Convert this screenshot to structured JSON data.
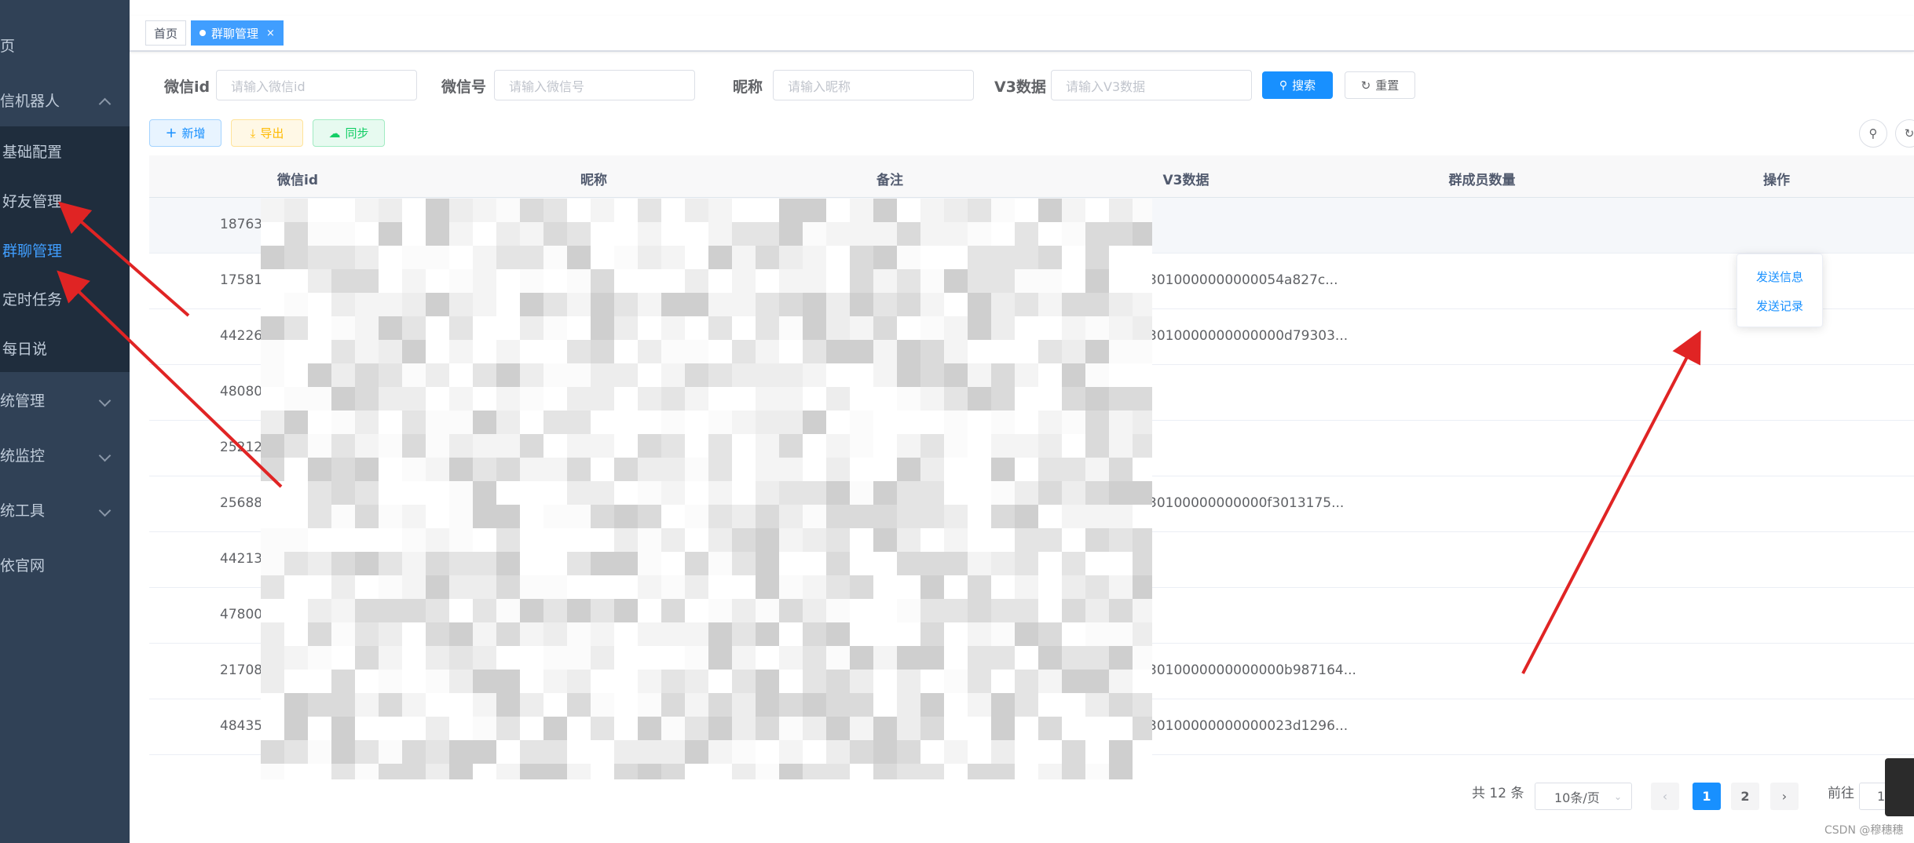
{
  "sidebar": {
    "items": [
      {
        "label": "页"
      },
      {
        "label": "信机器人"
      },
      {
        "label": "基础配置"
      },
      {
        "label": "好友管理"
      },
      {
        "label": "群聊管理"
      },
      {
        "label": "定时任务"
      },
      {
        "label": "每日说"
      },
      {
        "label": "统管理"
      },
      {
        "label": "统监控"
      },
      {
        "label": "统工具"
      },
      {
        "label": "依官网"
      }
    ]
  },
  "tabs": [
    {
      "label": "首页"
    },
    {
      "label": "群聊管理",
      "close": "×"
    }
  ],
  "search": {
    "fields": [
      {
        "label": "微信id",
        "placeholder": "请输入微信id"
      },
      {
        "label": "微信号",
        "placeholder": "请输入微信号"
      },
      {
        "label": "昵称",
        "placeholder": "请输入昵称"
      },
      {
        "label": "V3数据",
        "placeholder": "请输入V3数据"
      }
    ],
    "search_label": "搜索",
    "reset_label": "重置"
  },
  "toolbar": {
    "add_label": "新增",
    "export_label": "导出",
    "sync_label": "同步"
  },
  "table": {
    "headers": [
      "微信id",
      "昵称",
      "备注",
      "V3数据",
      "群成员数量",
      "操作"
    ],
    "rows": [
      {
        "id": "187634",
        "v3": ""
      },
      {
        "id": "175818",
        "v3": "3010000000000054a827c..."
      },
      {
        "id": "442267",
        "v3": "3010000000000000d79303..."
      },
      {
        "id": "480802",
        "v3": ""
      },
      {
        "id": "252122",
        "v3": ""
      },
      {
        "id": "256885",
        "v3": "30100000000000f3013175..."
      },
      {
        "id": "442130",
        "v3": ""
      },
      {
        "id": "478001",
        "v3": ""
      },
      {
        "id": "217082",
        "v3": "3010000000000000b987164..."
      },
      {
        "id": "484356",
        "v3": "30100000000000023d1296..."
      }
    ],
    "op_label": "操作"
  },
  "dropdown": {
    "items": [
      "发送信息",
      "发送记录"
    ]
  },
  "pagination": {
    "total": "共 12 条",
    "page_size": "10条/页",
    "pages": [
      "1",
      "2"
    ],
    "goto": "前往",
    "goto_value": "1"
  },
  "watermark": "CSDN @穆穗穗",
  "colors": {
    "primary": "#1890ff",
    "sidebar": "#304156",
    "arrow": "#e02424"
  }
}
